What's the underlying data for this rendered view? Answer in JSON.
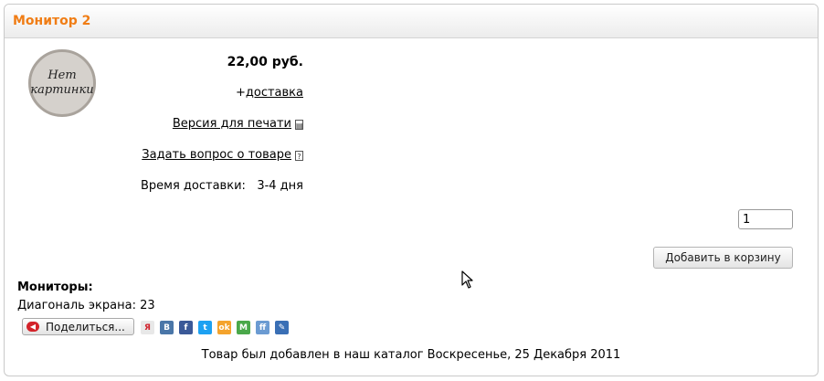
{
  "product": {
    "title": "Монитор 2",
    "no_image_text": "Нет\nкартинки",
    "price": "22,00 руб.",
    "delivery_prefix": "+",
    "delivery_link": "доставка",
    "print_link": "Версия для печати",
    "ask_link": "Задать вопрос о товаре",
    "delivery_time_label": "Время доставки:",
    "delivery_time_value": "3-4 дня",
    "quantity": "1",
    "add_to_cart": "Добавить в корзину"
  },
  "category": {
    "title": "Мониторы:",
    "attribute": "Диагональ экрана: 23"
  },
  "share": {
    "label": "Поделиться...",
    "services": [
      {
        "name": "yandex-icon",
        "glyph": "Я",
        "color": "#e8e8e8"
      },
      {
        "name": "vkontakte-icon",
        "glyph": "В",
        "color": "#4a76a8"
      },
      {
        "name": "facebook-icon",
        "glyph": "f",
        "color": "#3b5998"
      },
      {
        "name": "twitter-icon",
        "glyph": "t",
        "color": "#1da1f2"
      },
      {
        "name": "odnoklassniki-icon",
        "glyph": "ok",
        "color": "#f4a32c"
      },
      {
        "name": "moimir-icon",
        "glyph": "M",
        "color": "#4aa84a"
      },
      {
        "name": "friendfeed-icon",
        "glyph": "ff",
        "color": "#6b9bd2"
      },
      {
        "name": "livejournal-icon",
        "glyph": "✎",
        "color": "#3a6fb5"
      }
    ]
  },
  "footer": {
    "added_text": "Товар был добавлен в наш каталог Воскресенье, 25 Декабря 2011"
  },
  "colors": {
    "title_orange": "#f07d15"
  }
}
